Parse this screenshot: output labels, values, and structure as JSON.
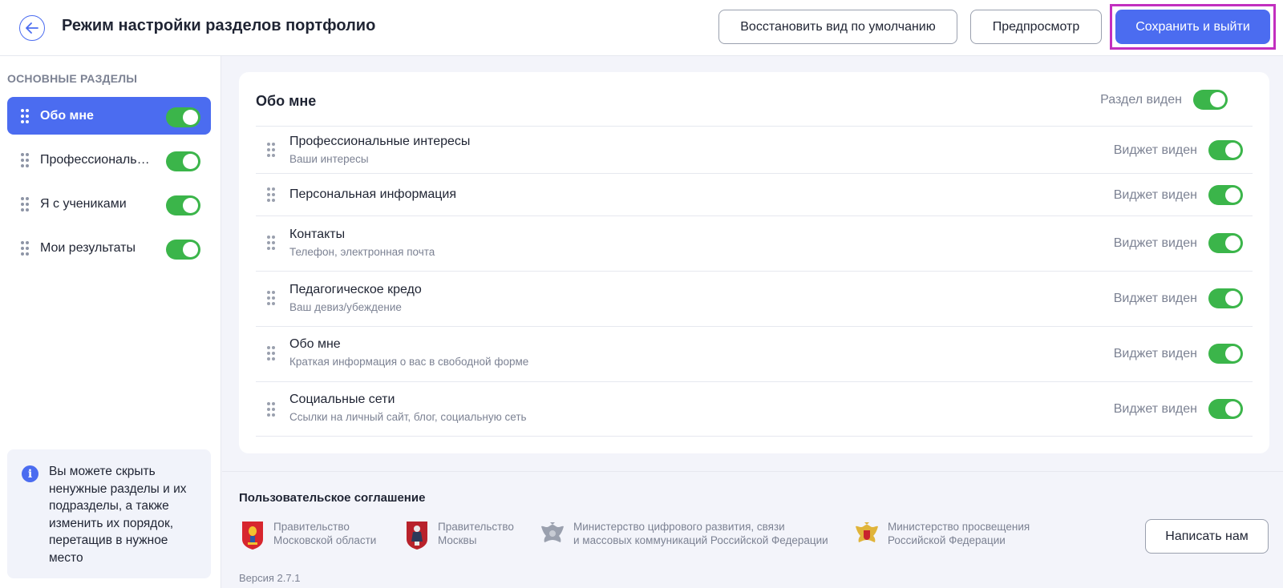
{
  "header": {
    "title": "Режим настройки разделов портфолио",
    "restore_label": "Восстановить вид по умолчанию",
    "preview_label": "Предпросмотр",
    "save_label": "Сохранить и выйти"
  },
  "sidebar": {
    "heading": "ОСНОВНЫЕ РАЗДЕЛЫ",
    "items": [
      {
        "label": "Обо мне",
        "active": true,
        "enabled": true
      },
      {
        "label": "Профессиональные интересы",
        "active": false,
        "enabled": true
      },
      {
        "label": "Я с учениками",
        "active": false,
        "enabled": true
      },
      {
        "label": "Мои результаты",
        "active": false,
        "enabled": true
      }
    ],
    "info_text": "Вы можете скрыть ненужные разделы и их подразделы, а также изменить их порядок, перетащив в нужное место"
  },
  "section": {
    "title": "Обо мне",
    "visibility_label": "Раздел виден",
    "enabled": true,
    "widgets": [
      {
        "title": "Профессиональные интересы",
        "subtitle": "Ваши интересы",
        "status": "Виджет виден",
        "enabled": true
      },
      {
        "title": "Персональная информация",
        "subtitle": "",
        "status": "Виджет виден",
        "enabled": true
      },
      {
        "title": "Контакты",
        "subtitle": "Телефон, электронная почта",
        "status": "Виджет виден",
        "enabled": true
      },
      {
        "title": "Педагогическое кредо",
        "subtitle": "Ваш девиз/убеждение",
        "status": "Виджет виден",
        "enabled": true
      },
      {
        "title": "Обо мне",
        "subtitle": "Краткая информация о вас в свободной форме",
        "status": "Виджет виден",
        "enabled": true
      },
      {
        "title": "Социальные сети",
        "subtitle": "Ссылки на личный сайт, блог, социальную сеть",
        "status": "Виджет виден",
        "enabled": true
      }
    ]
  },
  "footer": {
    "agreement": "Пользовательское соглашение",
    "partners": [
      {
        "text": "Правительство\nМосковской области",
        "icon": "moscow-oblast-emblem-icon"
      },
      {
        "text": "Правительство\nМосквы",
        "icon": "moscow-emblem-icon"
      },
      {
        "text": "Министерство цифрового развития, связи\nи массовых коммуникаций Российской Федерации",
        "icon": "russia-emblem-icon"
      },
      {
        "text": "Министерство просвещения\nРоссийской Федерации",
        "icon": "russia-emblem-color-icon"
      }
    ],
    "write_label": "Написать нам",
    "version": "Версия 2.7.1"
  },
  "colors": {
    "accent": "#4b6cf0",
    "toggle_on": "#3bb54a",
    "highlight": "#c22fbf"
  }
}
